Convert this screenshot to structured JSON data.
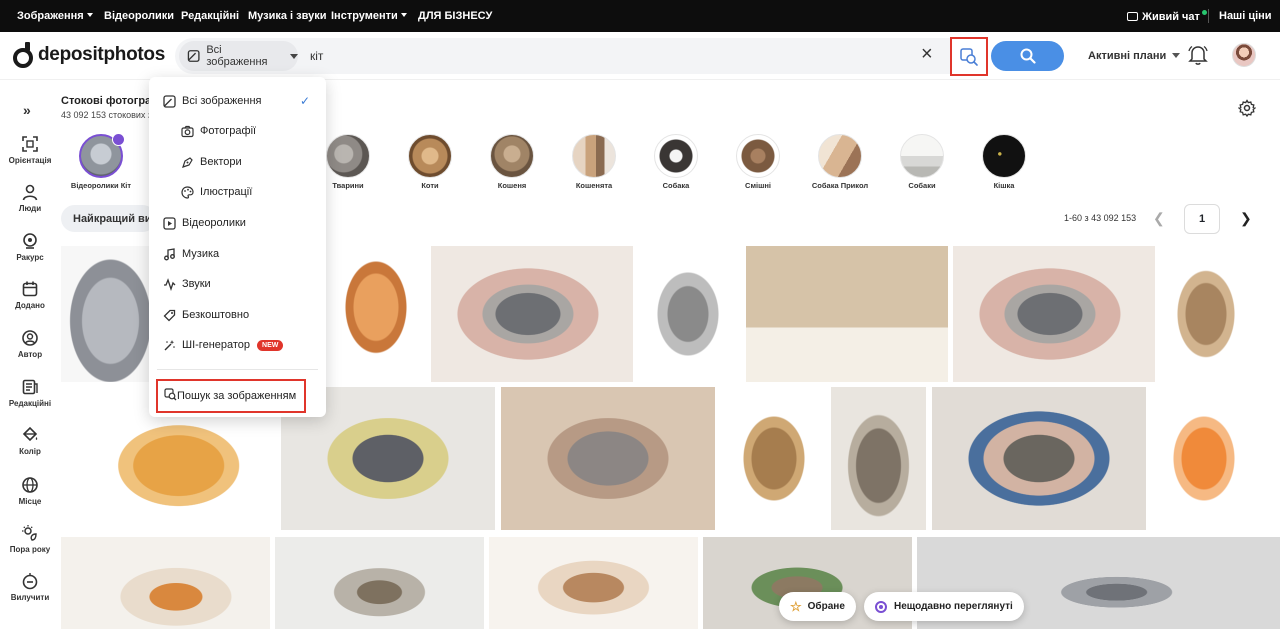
{
  "topbar": {
    "images": "Зображення",
    "videos": "Відеоролики",
    "editorial": "Редакційні",
    "music": "Музика і звуки",
    "tools": "Інструменти",
    "business": "ДЛЯ БІЗНЕСУ",
    "live_chat": "Живий чат",
    "prices": "Наші ціни"
  },
  "header": {
    "logo": "depositphotos",
    "scope_label": "Всі зображення",
    "query": "кіт",
    "plans_label": "Активні плани"
  },
  "sidebar": {
    "items": [
      {
        "label": "Орієнтація",
        "icon": "orientation-icon"
      },
      {
        "label": "Люди",
        "icon": "people-icon"
      },
      {
        "label": "Ракурс",
        "icon": "angle-icon"
      },
      {
        "label": "Додано",
        "icon": "calendar-icon"
      },
      {
        "label": "Автор",
        "icon": "author-icon"
      },
      {
        "label": "Редакційні",
        "icon": "editorial-icon"
      },
      {
        "label": "Колір",
        "icon": "color-bucket-icon"
      },
      {
        "label": "Місце",
        "icon": "globe-icon"
      },
      {
        "label": "Пора року",
        "icon": "season-icon"
      },
      {
        "label": "Вилучити",
        "icon": "exclude-icon"
      }
    ]
  },
  "page": {
    "title": "Стокові фотографії",
    "subtitle": "43 092 153 стокових з",
    "best_label": "Найкращий вибір",
    "range": "1-60 з 43 092 153",
    "page_number": "1"
  },
  "categories": [
    {
      "label": "Відеоролики Кіт",
      "color": "#9aa0a8"
    },
    {
      "label": "Тварини",
      "color": "#8f8a86"
    },
    {
      "label": "Коти",
      "color": "#b88a5a"
    },
    {
      "label": "Кошеня",
      "color": "#a08466"
    },
    {
      "label": "Кошенята",
      "color": "#c9a27c"
    },
    {
      "label": "Собака",
      "color": "#3a3634"
    },
    {
      "label": "Смішні",
      "color": "#7b5a40"
    },
    {
      "label": "Собака Прикол",
      "color": "#d9b592"
    },
    {
      "label": "Собаки",
      "color": "#d8d8d6"
    },
    {
      "label": "Кішка",
      "color": "#111111"
    }
  ],
  "dropdown": {
    "items": [
      {
        "label": "Всі зображення",
        "icon": "all-images-icon",
        "selected": true
      },
      {
        "label": "Фотографії",
        "icon": "camera-icon"
      },
      {
        "label": "Вектори",
        "icon": "vector-icon"
      },
      {
        "label": "Ілюстрації",
        "icon": "palette-icon"
      },
      {
        "label": "Відеоролики",
        "icon": "video-icon"
      },
      {
        "label": "Музика",
        "icon": "music-icon"
      },
      {
        "label": "Звуки",
        "icon": "sound-icon"
      },
      {
        "label": "Безкоштовно",
        "icon": "free-tag-icon"
      },
      {
        "label": "ШІ-генератор",
        "icon": "ai-generator-icon",
        "badge": "NEW"
      }
    ],
    "image_search": "Пошук за зображенням"
  },
  "chips": {
    "favorites": "Обране",
    "recent": "Нещодавно переглянуті"
  },
  "colors": {
    "accent_blue": "#4a8fe5",
    "highlight_red": "#e0352b",
    "purple": "#7a4fd3"
  }
}
